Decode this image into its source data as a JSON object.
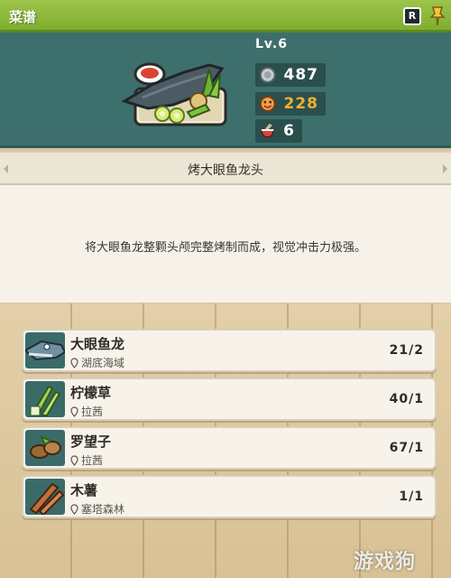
{
  "header": {
    "title": "菜谱",
    "key_label": "R"
  },
  "dish": {
    "level": "Lv.6",
    "stats": {
      "coin_value": "487",
      "flavor_value": "228",
      "servings_value": "6"
    },
    "stat_colors": {
      "coin": "#ffffff",
      "flavor": "#f2b033",
      "servings": "#ffffff"
    },
    "name": "烤大眼鱼龙头",
    "description": "将大眼鱼龙整颗头颅完整烤制而成，视觉冲击力极强。"
  },
  "ingredients": [
    {
      "name": "大眼鱼龙",
      "location": "湖底海域",
      "count": "21/2",
      "icon": "ichthyosaur-icon"
    },
    {
      "name": "柠檬草",
      "location": "拉茜",
      "count": "40/1",
      "icon": "lemongrass-icon"
    },
    {
      "name": "罗望子",
      "location": "拉茜",
      "count": "67/1",
      "icon": "tamarind-icon"
    },
    {
      "name": "木薯",
      "location": "塞塔森林",
      "count": "1/1",
      "icon": "cassava-icon"
    }
  ],
  "watermark": "游戏狗"
}
